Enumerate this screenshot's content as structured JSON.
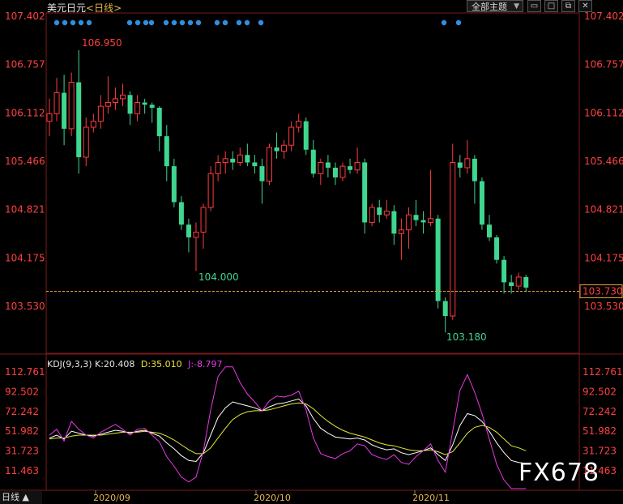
{
  "header": {
    "symbol": "美元日元",
    "timeframe": "<日线>",
    "dropdown_label": "全部主题",
    "icons": [
      "window-icon",
      "maximize-icon",
      "close-icon"
    ]
  },
  "price_axis": {
    "labels": [
      "107.402",
      "106.757",
      "106.112",
      "105.466",
      "104.821",
      "104.175",
      "103.530"
    ],
    "current": "103.730"
  },
  "annotations": {
    "high": "106.950",
    "low1": "104.000",
    "low2": "103.180"
  },
  "kdj": {
    "title": "KDJ(9,3,3)",
    "k_label": "K:20.408",
    "d_label": "D:35.010",
    "j_label": "J:-8.797",
    "axis_labels": [
      "112.761",
      "92.502",
      "72.242",
      "51.982",
      "31.723",
      "11.463"
    ]
  },
  "date_labels": [
    "2020/09",
    "2020/10",
    "2020/11"
  ],
  "footer": {
    "period": "日线 ▲"
  },
  "watermark": "FX678",
  "colors": {
    "up": "#ff3b3b",
    "down": "#3fd68f",
    "k": "#ffffff",
    "d": "#e8e83a",
    "j": "#e83ae8",
    "grid": "#7a1a1a",
    "current_line": "#e6a23c"
  },
  "chart_data": {
    "type": "candlestick",
    "title": "美元日元 日线",
    "ylim": [
      103.0,
      107.5
    ],
    "candles": [
      {
        "o": 106.0,
        "h": 106.3,
        "l": 105.8,
        "c": 106.1
      },
      {
        "o": 106.1,
        "h": 106.58,
        "l": 106.0,
        "c": 106.38
      },
      {
        "o": 106.38,
        "h": 106.62,
        "l": 105.68,
        "c": 105.9
      },
      {
        "o": 105.9,
        "h": 106.65,
        "l": 105.8,
        "c": 106.52
      },
      {
        "o": 106.52,
        "h": 106.95,
        "l": 105.3,
        "c": 105.52
      },
      {
        "o": 105.52,
        "h": 106.05,
        "l": 105.4,
        "c": 105.92
      },
      {
        "o": 105.92,
        "h": 106.1,
        "l": 105.85,
        "c": 106.0
      },
      {
        "o": 106.0,
        "h": 106.35,
        "l": 105.9,
        "c": 106.2
      },
      {
        "o": 106.2,
        "h": 106.6,
        "l": 106.1,
        "c": 106.25
      },
      {
        "o": 106.25,
        "h": 106.45,
        "l": 106.15,
        "c": 106.3
      },
      {
        "o": 106.3,
        "h": 106.5,
        "l": 106.2,
        "c": 106.35
      },
      {
        "o": 106.35,
        "h": 106.4,
        "l": 105.95,
        "c": 106.1
      },
      {
        "o": 106.1,
        "h": 106.35,
        "l": 106.0,
        "c": 106.25
      },
      {
        "o": 106.25,
        "h": 106.3,
        "l": 106.1,
        "c": 106.22
      },
      {
        "o": 106.22,
        "h": 106.25,
        "l": 105.98,
        "c": 106.18
      },
      {
        "o": 106.18,
        "h": 106.2,
        "l": 105.6,
        "c": 105.8
      },
      {
        "o": 105.8,
        "h": 105.95,
        "l": 105.2,
        "c": 105.4
      },
      {
        "o": 105.4,
        "h": 105.5,
        "l": 104.85,
        "c": 104.92
      },
      {
        "o": 104.92,
        "h": 105.0,
        "l": 104.55,
        "c": 104.62
      },
      {
        "o": 104.62,
        "h": 104.7,
        "l": 104.25,
        "c": 104.45
      },
      {
        "o": 104.45,
        "h": 104.65,
        "l": 104.0,
        "c": 104.52
      },
      {
        "o": 104.52,
        "h": 104.9,
        "l": 104.3,
        "c": 104.85
      },
      {
        "o": 104.85,
        "h": 105.4,
        "l": 104.8,
        "c": 105.3
      },
      {
        "o": 105.3,
        "h": 105.55,
        "l": 105.2,
        "c": 105.45
      },
      {
        "o": 105.45,
        "h": 105.6,
        "l": 105.3,
        "c": 105.5
      },
      {
        "o": 105.5,
        "h": 105.6,
        "l": 105.35,
        "c": 105.45
      },
      {
        "o": 105.45,
        "h": 105.65,
        "l": 105.4,
        "c": 105.55
      },
      {
        "o": 105.55,
        "h": 105.7,
        "l": 105.4,
        "c": 105.45
      },
      {
        "o": 105.45,
        "h": 105.55,
        "l": 105.3,
        "c": 105.4
      },
      {
        "o": 105.4,
        "h": 105.5,
        "l": 104.9,
        "c": 105.2
      },
      {
        "o": 105.2,
        "h": 105.7,
        "l": 105.15,
        "c": 105.65
      },
      {
        "o": 105.65,
        "h": 105.85,
        "l": 105.5,
        "c": 105.6
      },
      {
        "o": 105.6,
        "h": 105.75,
        "l": 105.5,
        "c": 105.68
      },
      {
        "o": 105.68,
        "h": 106.0,
        "l": 105.6,
        "c": 105.92
      },
      {
        "o": 105.92,
        "h": 106.1,
        "l": 105.85,
        "c": 106.0
      },
      {
        "o": 106.0,
        "h": 106.05,
        "l": 105.55,
        "c": 105.62
      },
      {
        "o": 105.62,
        "h": 105.75,
        "l": 105.25,
        "c": 105.3
      },
      {
        "o": 105.3,
        "h": 105.5,
        "l": 105.15,
        "c": 105.45
      },
      {
        "o": 105.45,
        "h": 105.55,
        "l": 105.25,
        "c": 105.38
      },
      {
        "o": 105.38,
        "h": 105.45,
        "l": 105.15,
        "c": 105.25
      },
      {
        "o": 105.25,
        "h": 105.45,
        "l": 105.2,
        "c": 105.4
      },
      {
        "o": 105.4,
        "h": 105.5,
        "l": 105.3,
        "c": 105.35
      },
      {
        "o": 105.35,
        "h": 105.65,
        "l": 105.3,
        "c": 105.45
      },
      {
        "o": 105.45,
        "h": 105.5,
        "l": 104.5,
        "c": 104.65
      },
      {
        "o": 104.65,
        "h": 104.9,
        "l": 104.6,
        "c": 104.85
      },
      {
        "o": 104.85,
        "h": 104.95,
        "l": 104.65,
        "c": 104.75
      },
      {
        "o": 104.75,
        "h": 104.95,
        "l": 104.7,
        "c": 104.8
      },
      {
        "o": 104.8,
        "h": 104.88,
        "l": 104.35,
        "c": 104.5
      },
      {
        "o": 104.5,
        "h": 104.7,
        "l": 104.15,
        "c": 104.55
      },
      {
        "o": 104.55,
        "h": 104.85,
        "l": 104.3,
        "c": 104.75
      },
      {
        "o": 104.75,
        "h": 104.95,
        "l": 104.6,
        "c": 104.68
      },
      {
        "o": 104.68,
        "h": 104.8,
        "l": 104.5,
        "c": 104.65
      },
      {
        "o": 104.65,
        "h": 105.35,
        "l": 104.6,
        "c": 104.7
      },
      {
        "o": 104.7,
        "h": 104.75,
        "l": 103.5,
        "c": 103.6
      },
      {
        "o": 103.6,
        "h": 103.65,
        "l": 103.18,
        "c": 103.4
      },
      {
        "o": 103.4,
        "h": 105.7,
        "l": 103.35,
        "c": 105.45
      },
      {
        "o": 105.45,
        "h": 105.55,
        "l": 105.25,
        "c": 105.38
      },
      {
        "o": 105.38,
        "h": 105.75,
        "l": 105.3,
        "c": 105.5
      },
      {
        "o": 105.5,
        "h": 105.55,
        "l": 104.9,
        "c": 105.2
      },
      {
        "o": 105.2,
        "h": 105.25,
        "l": 104.55,
        "c": 104.62
      },
      {
        "o": 104.62,
        "h": 104.75,
        "l": 104.4,
        "c": 104.45
      },
      {
        "o": 104.45,
        "h": 104.48,
        "l": 104.1,
        "c": 104.15
      },
      {
        "o": 104.15,
        "h": 104.2,
        "l": 103.7,
        "c": 103.85
      },
      {
        "o": 103.85,
        "h": 103.95,
        "l": 103.7,
        "c": 103.8
      },
      {
        "o": 103.8,
        "h": 103.98,
        "l": 103.75,
        "c": 103.92
      },
      {
        "o": 103.92,
        "h": 103.95,
        "l": 103.72,
        "c": 103.78
      }
    ],
    "kdj": {
      "k": [
        45,
        48,
        44,
        52,
        50,
        48,
        47,
        49,
        51,
        53,
        52,
        50,
        52,
        53,
        50,
        47,
        40,
        34,
        27,
        22,
        21,
        30,
        48,
        66,
        76,
        82,
        80,
        78,
        76,
        73,
        77,
        80,
        81,
        83,
        85,
        78,
        65,
        55,
        50,
        46,
        45,
        44,
        45,
        43,
        38,
        35,
        33,
        34,
        30,
        28,
        30,
        32,
        35,
        28,
        22,
        38,
        58,
        70,
        68,
        62,
        52,
        40,
        30,
        22,
        20,
        19
      ],
      "d": [
        44,
        45,
        45,
        47,
        48,
        48,
        48,
        48,
        49,
        50,
        51,
        51,
        51,
        52,
        51,
        50,
        47,
        43,
        38,
        33,
        29,
        29,
        35,
        45,
        55,
        64,
        69,
        72,
        73,
        73,
        74,
        76,
        78,
        80,
        81,
        80,
        75,
        68,
        62,
        57,
        53,
        50,
        48,
        46,
        43,
        40,
        38,
        37,
        35,
        33,
        32,
        32,
        33,
        31,
        28,
        31,
        40,
        50,
        56,
        58,
        56,
        51,
        44,
        37,
        35,
        32
      ],
      "j": [
        48,
        54,
        42,
        62,
        54,
        48,
        45,
        51,
        55,
        59,
        54,
        48,
        54,
        55,
        48,
        41,
        26,
        16,
        5,
        0,
        5,
        32,
        74,
        108,
        118,
        118,
        102,
        90,
        82,
        73,
        83,
        88,
        87,
        89,
        93,
        74,
        45,
        29,
        26,
        24,
        29,
        32,
        39,
        37,
        28,
        25,
        23,
        28,
        20,
        18,
        26,
        32,
        39,
        22,
        10,
        52,
        94,
        110,
        92,
        70,
        44,
        18,
        2,
        -8,
        -10,
        -8.797
      ]
    }
  }
}
